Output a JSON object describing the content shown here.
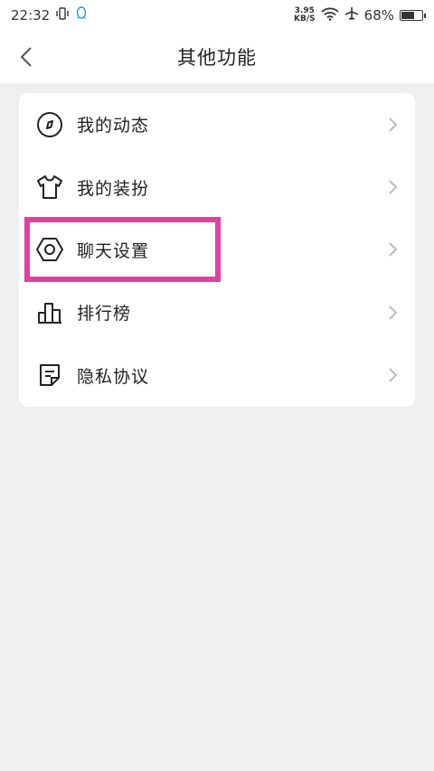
{
  "status_bar": {
    "time": "22:32",
    "net_speed_value": "3.95",
    "net_speed_unit": "KB/S",
    "battery_text": "68%",
    "battery_level": 0.68
  },
  "nav": {
    "title": "其他功能"
  },
  "menu": {
    "items": [
      {
        "label": "我的动态",
        "icon": "compass-icon"
      },
      {
        "label": "我的装扮",
        "icon": "tshirt-icon"
      },
      {
        "label": "聊天设置",
        "icon": "settings-hexagon-icon",
        "highlighted": true
      },
      {
        "label": "排行榜",
        "icon": "ranking-bars-icon"
      },
      {
        "label": "隐私协议",
        "icon": "document-icon"
      }
    ]
  },
  "colors": {
    "highlight": "#e040a0",
    "background": "#efefef",
    "card": "#ffffff"
  }
}
